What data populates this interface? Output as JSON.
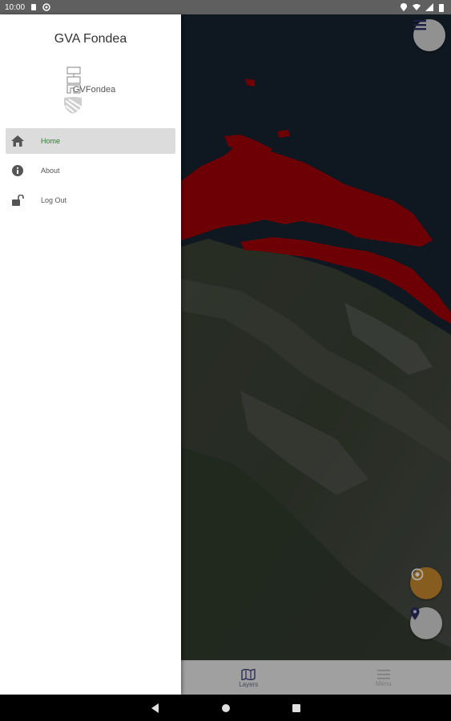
{
  "status_bar": {
    "time": "10:00"
  },
  "drawer": {
    "title": "GVA Fondea",
    "logo_text": "GVFondea",
    "menu": [
      {
        "label": "Home",
        "icon": "home-icon",
        "active": true
      },
      {
        "label": "About",
        "icon": "info-icon",
        "active": false
      },
      {
        "label": "Log Out",
        "icon": "unlock-icon",
        "active": false
      }
    ]
  },
  "bottom_nav": {
    "items": [
      {
        "label": "Layers",
        "icon": "map-icon"
      },
      {
        "label": "Menu",
        "icon": "menu-icon"
      }
    ]
  },
  "colors": {
    "accent": "#2e7d32",
    "overlay": "#a00008",
    "locate_fab": "#c8892e",
    "pin_fab": "#d6d6d6"
  },
  "fabs": {
    "top_right": "menu-icon",
    "locate": "target-icon",
    "pin": "map-pin-icon"
  }
}
